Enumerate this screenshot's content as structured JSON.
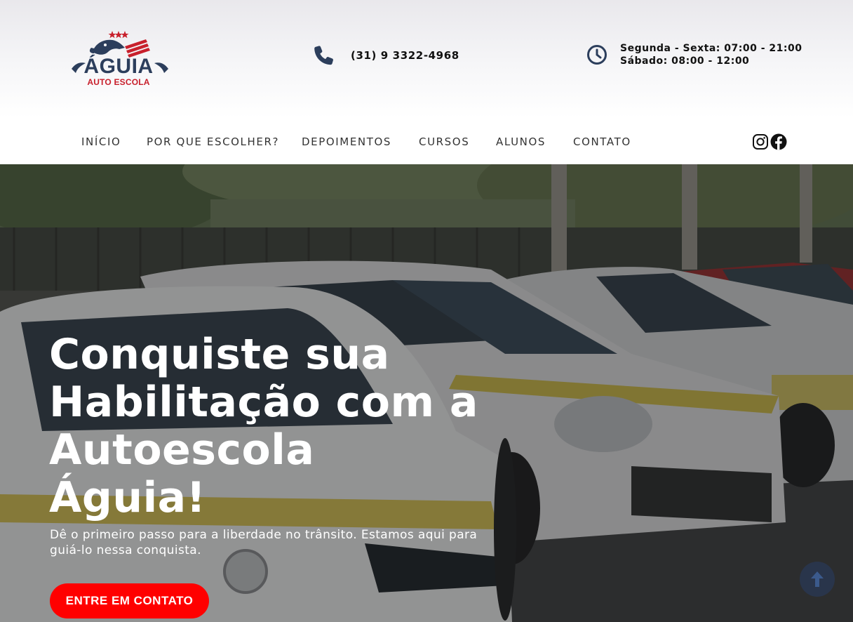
{
  "brand": {
    "name": "ÁGUIA",
    "subtitle": "AUTO ESCOLA",
    "colors": {
      "navy": "#2c3e5c",
      "red": "#c8202c"
    }
  },
  "contact": {
    "phone_icon": "phone-icon",
    "phone": "(31) 9 3322-4968",
    "clock_icon": "clock-icon",
    "hours_weekdays": "Segunda - Sexta: 07:00 - 21:00",
    "hours_saturday": "Sábado: 08:00 - 12:00"
  },
  "nav": {
    "items": [
      {
        "label": "INÍCIO"
      },
      {
        "label": "POR QUE ESCOLHER?"
      },
      {
        "label": "DEPOIMENTOS"
      },
      {
        "label": "CURSOS"
      },
      {
        "label": "ALUNOS"
      },
      {
        "label": "CONTATO"
      }
    ],
    "social": [
      "instagram-icon",
      "facebook-icon"
    ]
  },
  "hero": {
    "title_lines": [
      "Conquiste sua",
      "Habilitação com a",
      "Autoescola",
      "Águia!"
    ],
    "subtitle": "Dê o primeiro passo para a liberdade no trânsito. Estamos aqui para guiá-lo nessa conquista.",
    "cta_label": "ENTRE EM CONTATO",
    "cta_color": "#ff0000",
    "scroll_top_icon": "arrow-up-icon"
  }
}
